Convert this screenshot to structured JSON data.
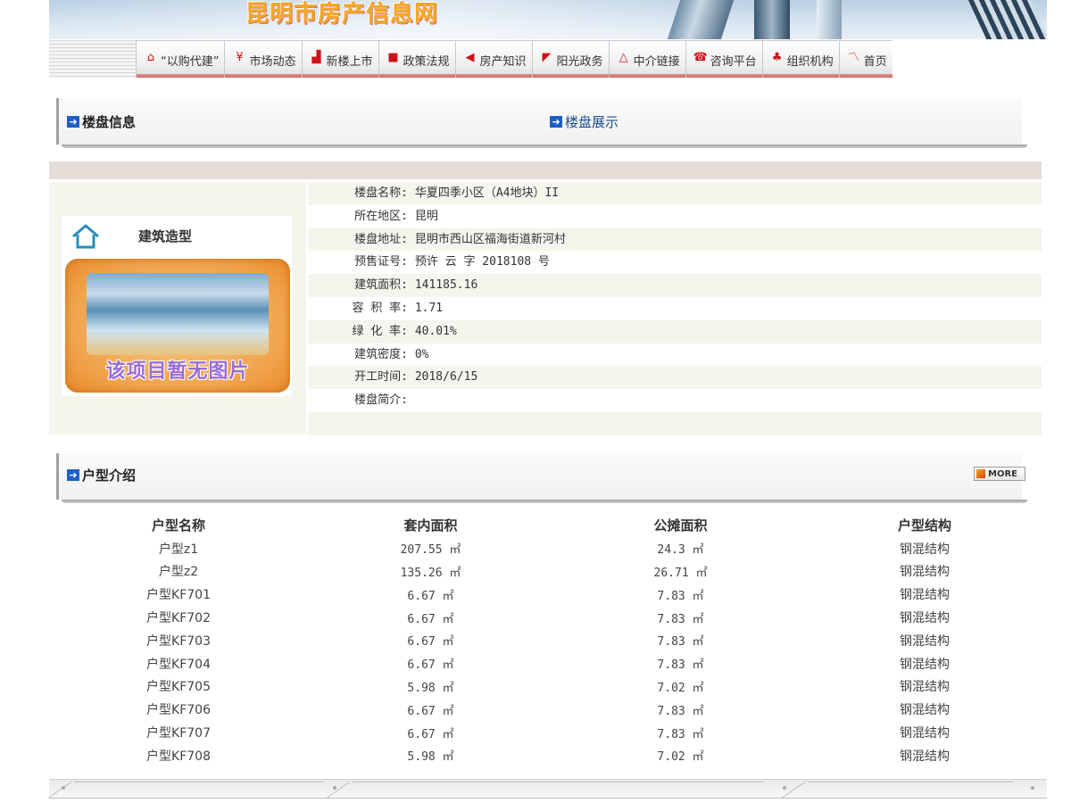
{
  "site": {
    "title": "昆明市房产信息网"
  },
  "nav": [
    {
      "icon": "house-icon",
      "label": "“以购代建”"
    },
    {
      "icon": "yen-icon",
      "label": "市场动态"
    },
    {
      "icon": "bar-chart-icon",
      "label": "新楼上市"
    },
    {
      "icon": "book-icon",
      "label": "政策法规"
    },
    {
      "icon": "arrow-left-icon",
      "label": "房产知识"
    },
    {
      "icon": "flag-icon",
      "label": "阳光政务"
    },
    {
      "icon": "triangle-icon",
      "label": "中介链接"
    },
    {
      "icon": "phone-icon",
      "label": "咨询平台"
    },
    {
      "icon": "org-icon",
      "label": "组织机构"
    },
    {
      "icon": "swoosh-icon",
      "label": "首页"
    }
  ],
  "project_section": {
    "title": "楼盘信息",
    "link": "楼盘展示"
  },
  "building_card": {
    "title": "建筑造型",
    "photo_caption": "该项目暂无图片"
  },
  "info": [
    {
      "label": "楼盘名称:",
      "value": "华夏四季小区（A4地块）II"
    },
    {
      "label": "所在地区:",
      "value": "昆明"
    },
    {
      "label": "楼盘地址:",
      "value": "昆明市西山区福海街道新河村"
    },
    {
      "label": "预售证号:",
      "value": "预许 云 字 2018108 号"
    },
    {
      "label": "建筑面积:",
      "value": "141185.16"
    },
    {
      "label": "容 积 率:",
      "value": "1.71"
    },
    {
      "label": "绿 化 率:",
      "value": "40.01%"
    },
    {
      "label": "建筑密度:",
      "value": "0%"
    },
    {
      "label": "开工时间:",
      "value": "2018/6/15"
    },
    {
      "label": "楼盘简介:",
      "value": ""
    }
  ],
  "units_section": {
    "title": "户型介绍",
    "more_label": "MORE"
  },
  "units_table": {
    "headers": [
      "户型名称",
      "套内面积",
      "公摊面积",
      "户型结构"
    ],
    "rows": [
      [
        "户型z1",
        "207.55 ㎡",
        "24.3 ㎡",
        "钢混结构"
      ],
      [
        "户型z2",
        "135.26 ㎡",
        "26.71 ㎡",
        "钢混结构"
      ],
      [
        "户型KF701",
        "6.67 ㎡",
        "7.83 ㎡",
        "钢混结构"
      ],
      [
        "户型KF702",
        "6.67 ㎡",
        "7.83 ㎡",
        "钢混结构"
      ],
      [
        "户型KF703",
        "6.67 ㎡",
        "7.83 ㎡",
        "钢混结构"
      ],
      [
        "户型KF704",
        "6.67 ㎡",
        "7.83 ㎡",
        "钢混结构"
      ],
      [
        "户型KF705",
        "5.98 ㎡",
        "7.02 ㎡",
        "钢混结构"
      ],
      [
        "户型KF706",
        "6.67 ㎡",
        "7.83 ㎡",
        "钢混结构"
      ],
      [
        "户型KF707",
        "6.67 ㎡",
        "7.83 ㎡",
        "钢混结构"
      ],
      [
        "户型KF708",
        "5.98 ㎡",
        "7.02 ㎡",
        "钢混结构"
      ]
    ]
  },
  "colors": {
    "accent_blue": "#1d5fc4",
    "nav_underline": "#c96a6a",
    "title_orange": "#f5a623"
  }
}
